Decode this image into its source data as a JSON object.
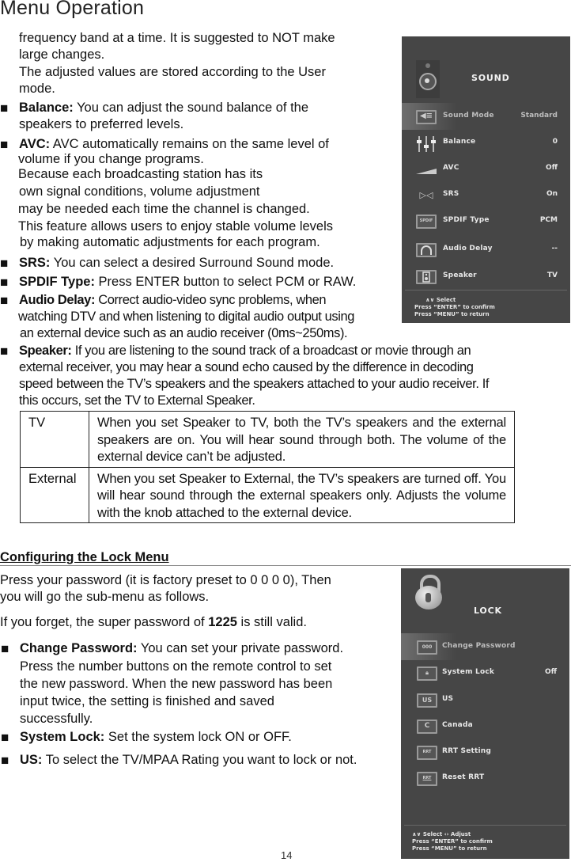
{
  "page": {
    "title": "Menu Operation",
    "page_number": "14"
  },
  "sound_section": {
    "intro_lines": [
      "frequency band at a time. It is suggested to NOT make",
      "large changes.",
      "The adjusted values are stored according to the User",
      "mode."
    ],
    "balance": {
      "label": "Balance:",
      "lines": [
        " You can adjust the sound balance of the",
        "speakers to preferred levels."
      ]
    },
    "avc": {
      "label": "AVC:",
      "lines": [
        " AVC automatically remains on the same level of",
        "volume if you change programs.",
        "Because each broadcasting station has its",
        "own signal conditions, volume adjustment",
        "may be needed each time the channel is changed.",
        "This feature allows users to enjoy stable volume levels",
        "by making automatic adjustments for each program."
      ]
    },
    "srs": {
      "label": "SRS:",
      "text": " You can select a desired Surround Sound mode."
    },
    "spdif": {
      "label": "SPDIF Type:",
      "text": " Press ENTER button to select PCM or RAW."
    },
    "audio_delay": {
      "label": "Audio Delay:",
      "lines": [
        " Correct audio-video sync problems, when",
        "watching DTV and when listening to digital audio output using",
        "an external device such as an audio receiver (0ms~250ms)."
      ]
    },
    "speaker": {
      "label": "Speaker:",
      "lines": [
        " If you are listening to the sound track of a broadcast or movie through an",
        "external receiver, you may hear a sound echo caused by the difference in decoding",
        "speed between the TV’s speakers and the speakers attached to your audio receiver. If",
        "this occurs, set the TV to External Speaker."
      ]
    },
    "speaker_table": [
      {
        "option": "TV",
        "description": "When you set Speaker to TV, both the TV’s speakers and the external speakers are on. You will hear sound through both. The volume of the external device can’t be adjusted."
      },
      {
        "option": "External",
        "description": "When you set Speaker to External, the TV’s speakers are turned off. You will hear sound through the external speakers only. Adjusts the volume with the knob attached to the external device."
      }
    ]
  },
  "sound_menu": {
    "title": "SOUND",
    "items": [
      {
        "icon": "speaker-mode-icon",
        "label": "Sound Mode",
        "value": "Standard",
        "selected": true
      },
      {
        "icon": "equalizer-sliders-icon",
        "label": "Balance",
        "value": "0"
      },
      {
        "icon": "volume-ramp-icon",
        "label": "AVC",
        "value": "Off"
      },
      {
        "icon": "surround-icon",
        "label": "SRS",
        "value": "On"
      },
      {
        "icon": "spdif-icon",
        "label": "SPDIF Type",
        "value": "PCM",
        "icon_text": "SPDIF"
      },
      {
        "icon": "headphones-icon",
        "label": "Audio Delay",
        "value": "--"
      },
      {
        "icon": "speaker-box-icon",
        "label": "Speaker",
        "value": "TV"
      }
    ],
    "help": [
      "Select",
      "Press “ENTER” to confirm",
      "Press “MENU” to return"
    ]
  },
  "lock_section": {
    "heading": "Configuring the Lock Menu",
    "intro_lines": [
      "Press your password (it is factory preset to 0 0 0 0), Then",
      "you will go the sub-menu as follows."
    ],
    "super_password": {
      "prefix": "If you forget, the super password of ",
      "code": "1225",
      "suffix": " is still valid."
    },
    "change_password": {
      "label": "Change Password:",
      "lines": [
        " You can set your private password.",
        "Press the number buttons on the remote control to set",
        "the new password. When the new password has been",
        "input twice, the setting is finished and saved",
        "successfully."
      ]
    },
    "system_lock": {
      "label": "System Lock:",
      "text": " Set the system lock ON or OFF."
    },
    "us": {
      "label": "US:",
      "text": " To select the TV/MPAA Rating you want to lock or not."
    }
  },
  "lock_menu": {
    "title": "LOCK",
    "items": [
      {
        "icon": "password-field-icon",
        "label": "Change Password",
        "value": "",
        "selected": true,
        "icon_text": "000"
      },
      {
        "icon": "padlock-icon",
        "label": "System Lock",
        "value": "Off"
      },
      {
        "icon": "us-rating-icon",
        "label": "US",
        "value": "",
        "icon_text": "US"
      },
      {
        "icon": "canada-rating-icon",
        "label": "Canada",
        "value": "",
        "icon_text": "C"
      },
      {
        "icon": "rrt-icon",
        "label": "RRT Setting",
        "value": "",
        "icon_text": "RRT"
      },
      {
        "icon": "reset-rrt-icon",
        "label": "Reset RRT",
        "value": "",
        "icon_text": "RRT"
      }
    ],
    "help": [
      "Select",
      "Adjust",
      "Press “ENTER” to confirm",
      "Press “MENU” to return"
    ]
  }
}
